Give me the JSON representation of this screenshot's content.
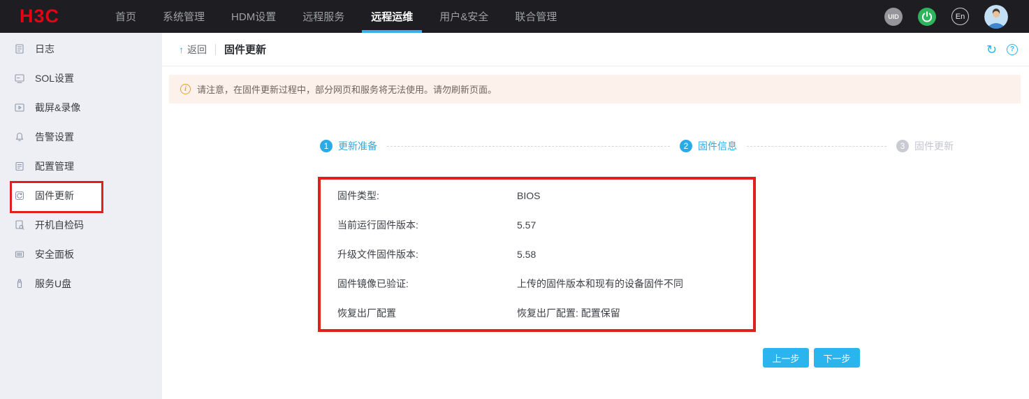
{
  "navbar": {
    "logo": "H3C",
    "items": [
      {
        "label": "首页",
        "active": false
      },
      {
        "label": "系统管理",
        "active": false
      },
      {
        "label": "HDM设置",
        "active": false
      },
      {
        "label": "远程服务",
        "active": false
      },
      {
        "label": "远程运维",
        "active": true
      },
      {
        "label": "用户&安全",
        "active": false
      },
      {
        "label": "联合管理",
        "active": false
      }
    ],
    "uid_badge": "UID",
    "lang_badge": "En",
    "icons": [
      "uid-indicator",
      "power-icon",
      "language-toggle",
      "avatar"
    ]
  },
  "sidebar": {
    "items": [
      {
        "icon": "log-icon",
        "label": "日志",
        "selected": false
      },
      {
        "icon": "sol-settings-icon",
        "label": "SOL设置",
        "selected": false
      },
      {
        "icon": "screen-record-icon",
        "label": "截屏&录像",
        "selected": false
      },
      {
        "icon": "alarm-settings-icon",
        "label": "告警设置",
        "selected": false
      },
      {
        "icon": "config-management-icon",
        "label": "配置管理",
        "selected": false
      },
      {
        "icon": "firmware-update-icon",
        "label": "固件更新",
        "selected": true,
        "annotated": "red-box"
      },
      {
        "icon": "post-code-icon",
        "label": "开机自检码",
        "selected": false
      },
      {
        "icon": "secure-panel-icon",
        "label": "安全面板",
        "selected": false
      },
      {
        "icon": "service-usb-icon",
        "label": "服务U盘",
        "selected": false
      }
    ]
  },
  "page": {
    "back_label": "返回",
    "title": "固件更新",
    "notice": "请注意，在固件更新过程中，部分网页和服务将无法使用。请勿刷新页面。",
    "steps": [
      {
        "num": "1",
        "label": "更新准备",
        "state": "active"
      },
      {
        "num": "2",
        "label": "固件信息",
        "state": "active"
      },
      {
        "num": "3",
        "label": "固件更新",
        "state": "pending"
      }
    ],
    "info_rows": [
      {
        "label": "固件类型:",
        "value": "BIOS"
      },
      {
        "label": "当前运行固件版本:",
        "value": "5.57"
      },
      {
        "label": "升级文件固件版本:",
        "value": "5.58"
      },
      {
        "label": "固件镜像已验证:",
        "value": "上传的固件版本和现有的设备固件不同"
      },
      {
        "label": "恢复出厂配置",
        "value": "恢复出厂配置: 配置保留"
      }
    ],
    "buttons": {
      "prev": "上一步",
      "next": "下一步"
    },
    "refresh_icon": "↻",
    "help_icon": "?",
    "back_arrow": "↑"
  },
  "colors": {
    "accent_blue": "#2aabe8",
    "button_blue": "#2ab5ef",
    "annotation_red": "#e01f1f",
    "logo_red": "#e60012",
    "navbar_bg": "#1e1e22",
    "sidebar_bg": "#edeff4",
    "banner_bg": "#fdf1ec",
    "banner_orange": "#dfa03c",
    "power_green": "#2db45d"
  }
}
